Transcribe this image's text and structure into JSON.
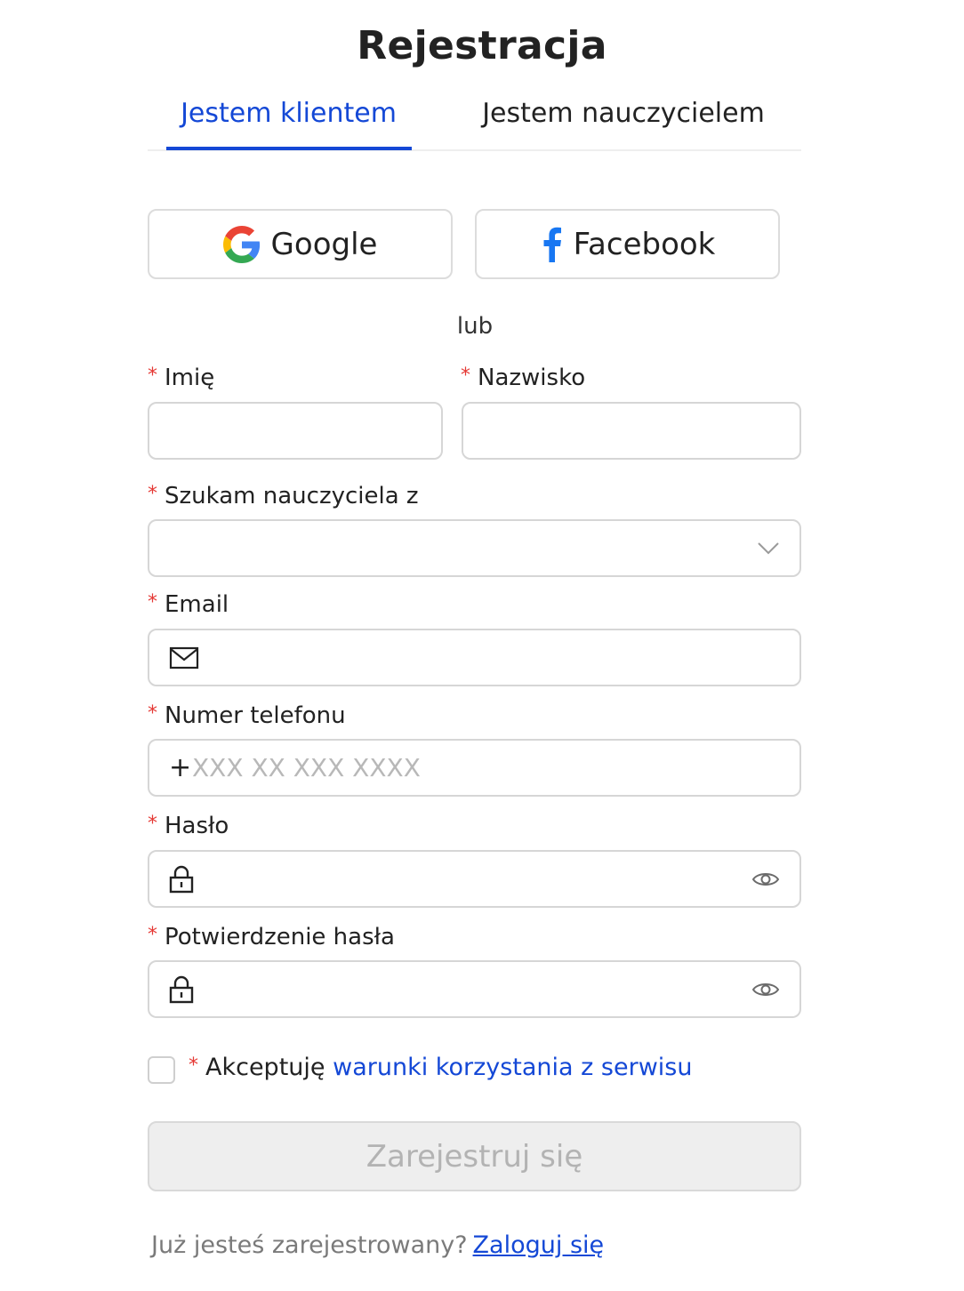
{
  "title": "Rejestracja",
  "tabs": [
    {
      "label": "Jestem klientem",
      "active": true
    },
    {
      "label": "Jestem nauczycielem",
      "active": false
    }
  ],
  "social": {
    "google_label": "Google",
    "facebook_label": "Facebook",
    "google_icon": "google-g-icon",
    "facebook_icon": "facebook-f-icon"
  },
  "or_text": "lub",
  "required_mark": "*",
  "form": {
    "first_name": {
      "label": "Imię",
      "value": ""
    },
    "last_name": {
      "label": "Nazwisko",
      "value": ""
    },
    "subject": {
      "label": "Szukam nauczyciela z",
      "value": "",
      "icon": "chevron-down-icon"
    },
    "email": {
      "label": "Email",
      "value": "",
      "icon": "envelope-icon"
    },
    "phone": {
      "label": "Numer telefonu",
      "prefix": "+",
      "placeholder": "XXX XX XXX XXXX",
      "value": ""
    },
    "password": {
      "label": "Hasło",
      "value": "",
      "lead_icon": "lock-icon",
      "trail_icon": "eye-icon"
    },
    "password_confirm": {
      "label": "Potwierdzenie hasła",
      "value": "",
      "lead_icon": "lock-icon",
      "trail_icon": "eye-icon"
    }
  },
  "terms": {
    "checked": false,
    "text": "Akceptuję",
    "link": "warunki korzystania z serwisu"
  },
  "submit_label": "Zarejestruj się",
  "login": {
    "text": "Już jesteś zarejestrowany?",
    "link": "Zaloguj się"
  },
  "colors": {
    "accent": "#1448d6",
    "required": "#e53935",
    "facebook": "#1877f2",
    "disabled_bg": "#eeeeee",
    "disabled_text": "#b3b3b3"
  }
}
